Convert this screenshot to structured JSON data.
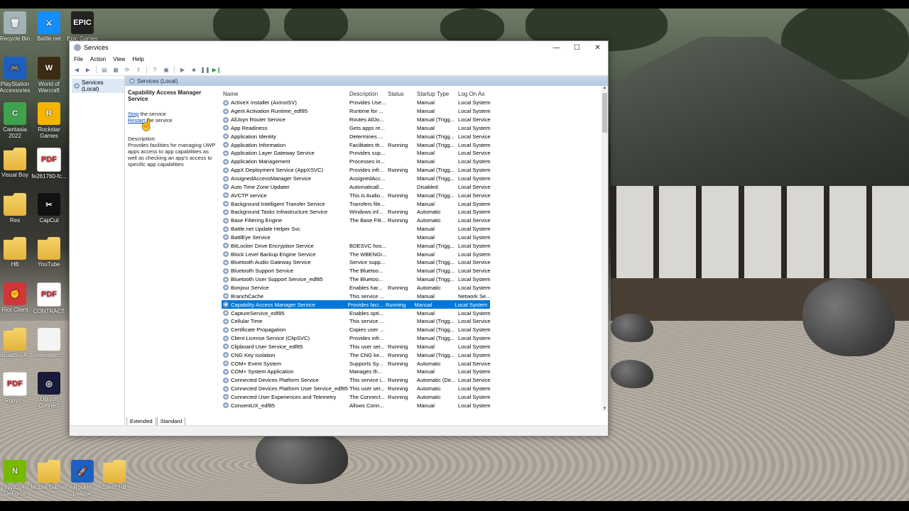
{
  "desktop": {
    "icons": [
      {
        "label": "Recycle Bin",
        "glyph": "🗑",
        "kind": "bin"
      },
      {
        "label": "Battle.net",
        "glyph": "⚔",
        "kind": "app",
        "color": "#148eff"
      },
      {
        "label": "Epic Games",
        "glyph": "EPIC",
        "kind": "app",
        "color": "#222222"
      },
      {
        "label": "PlayStation Accessories",
        "glyph": "🎮",
        "kind": "app",
        "color": "#1d5fbf"
      },
      {
        "label": "World of Warcraft",
        "glyph": "W",
        "kind": "app",
        "color": "#3b2b12"
      },
      {
        "label": "Camtasia 2022",
        "glyph": "C",
        "kind": "app",
        "color": "#3fa34d"
      },
      {
        "label": "Rockstar Games",
        "glyph": "R",
        "kind": "app",
        "color": "#f5b400"
      },
      {
        "label": "Visual Boy",
        "glyph": "",
        "kind": "folder"
      },
      {
        "label": "fe261760-fc...",
        "glyph": "PDF",
        "kind": "pdf"
      },
      {
        "label": "Res",
        "glyph": "",
        "kind": "folder"
      },
      {
        "label": "CapCut",
        "glyph": "✂",
        "kind": "app",
        "color": "#111111"
      },
      {
        "label": "HB",
        "glyph": "",
        "kind": "folder"
      },
      {
        "label": "YouTube",
        "glyph": "",
        "kind": "folder"
      },
      {
        "label": "Riot Client",
        "glyph": "✊",
        "kind": "app",
        "color": "#d13639"
      },
      {
        "label": "CONTRACT",
        "glyph": "PDF",
        "kind": "pdf"
      },
      {
        "label": "VisualBoyA...",
        "glyph": "",
        "kind": "folder"
      },
      {
        "label": "Investwith...",
        "glyph": "",
        "kind": "file"
      },
      {
        "label": "Robyn's",
        "glyph": "PDF",
        "kind": "pdf"
      },
      {
        "label": "Ubisoft Connect",
        "glyph": "◎",
        "kind": "app",
        "color": "#1a1a3a"
      },
      {
        "label": "NVIDIA GeForce",
        "glyph": "N",
        "kind": "app",
        "color": "#76b900"
      },
      {
        "label": "Mobile Games",
        "glyph": "",
        "kind": "folder"
      },
      {
        "label": "Rocket League",
        "glyph": "🚀",
        "kind": "app",
        "color": "#1f5fbf"
      },
      {
        "label": "Silent Hill",
        "glyph": "",
        "kind": "folder"
      }
    ]
  },
  "window": {
    "title": "Services",
    "controls": {
      "minimize": "—",
      "maximize": "☐",
      "close": "✕"
    },
    "menu": [
      "File",
      "Action",
      "View",
      "Help"
    ],
    "tree_node": "Services (Local)",
    "content_header": "Services (Local)",
    "selected_service": {
      "title": "Capability Access Manager Service",
      "stop_link": "Stop",
      "stop_suffix": " the service",
      "restart_link": "Restart",
      "restart_suffix": " the service",
      "description_label": "Description:",
      "description": "Provides facilities for managing UWP apps access to app capabilities as well as checking an app's access to specific app capabilities"
    },
    "columns": [
      "Name",
      "Description",
      "Status",
      "Startup Type",
      "Log On As"
    ],
    "rows": [
      [
        "ActiveX Installer (AxInstSV)",
        "Provides Use...",
        "",
        "Manual",
        "Local System"
      ],
      [
        "Agent Activation Runtime_edf85",
        "Runtime for ...",
        "",
        "Manual",
        "Local System"
      ],
      [
        "AllJoyn Router Service",
        "Routes AllJo...",
        "",
        "Manual (Trigg...",
        "Local Service"
      ],
      [
        "App Readiness",
        "Gets apps re...",
        "",
        "Manual",
        "Local System"
      ],
      [
        "Application Identity",
        "Determines ...",
        "",
        "Manual (Trigg...",
        "Local Service"
      ],
      [
        "Application Information",
        "Facilitates th...",
        "Running",
        "Manual (Trigg...",
        "Local System"
      ],
      [
        "Application Layer Gateway Service",
        "Provides sup...",
        "",
        "Manual",
        "Local Service"
      ],
      [
        "Application Management",
        "Processes in...",
        "",
        "Manual",
        "Local System"
      ],
      [
        "AppX Deployment Service (AppXSVC)",
        "Provides infr...",
        "Running",
        "Manual (Trigg...",
        "Local System"
      ],
      [
        "AssignedAccessManager Service",
        "AssignedAcc...",
        "",
        "Manual (Trigg...",
        "Local System"
      ],
      [
        "Auto Time Zone Updater",
        "Automaticall...",
        "",
        "Disabled",
        "Local Service"
      ],
      [
        "AVCTP service",
        "This is Audio...",
        "Running",
        "Manual (Trigg...",
        "Local Service"
      ],
      [
        "Background Intelligent Transfer Service",
        "Transfers file...",
        "",
        "Manual",
        "Local System"
      ],
      [
        "Background Tasks Infrastructure Service",
        "Windows inf...",
        "Running",
        "Automatic",
        "Local System"
      ],
      [
        "Base Filtering Engine",
        "The Base Filt...",
        "Running",
        "Automatic",
        "Local Service"
      ],
      [
        "Battle.net Update Helper Svc",
        "",
        "",
        "Manual",
        "Local System"
      ],
      [
        "BattlEye Service",
        "",
        "",
        "Manual",
        "Local System"
      ],
      [
        "BitLocker Drive Encryption Service",
        "BDESVC hos...",
        "",
        "Manual (Trigg...",
        "Local System"
      ],
      [
        "Block Level Backup Engine Service",
        "The WBENGI...",
        "",
        "Manual",
        "Local System"
      ],
      [
        "Bluetooth Audio Gateway Service",
        "Service supp...",
        "",
        "Manual (Trigg...",
        "Local Service"
      ],
      [
        "Bluetooth Support Service",
        "The Bluetoo...",
        "",
        "Manual (Trigg...",
        "Local Service"
      ],
      [
        "Bluetooth User Support Service_edf85",
        "The Bluetoo...",
        "",
        "Manual (Trigg...",
        "Local System"
      ],
      [
        "Bonjour Service",
        "Enables har...",
        "Running",
        "Automatic",
        "Local System"
      ],
      [
        "BranchCache",
        "This service ...",
        "",
        "Manual",
        "Network Se..."
      ],
      [
        "Capability Access Manager Service",
        "Provides faci...",
        "Running",
        "Manual",
        "Local System"
      ],
      [
        "CaptureService_edf85",
        "Enables opti...",
        "",
        "Manual",
        "Local System"
      ],
      [
        "Cellular Time",
        "This service ...",
        "",
        "Manual (Trigg...",
        "Local Service"
      ],
      [
        "Certificate Propagation",
        "Copies user ...",
        "",
        "Manual (Trigg...",
        "Local System"
      ],
      [
        "Client License Service (ClipSVC)",
        "Provides infr...",
        "",
        "Manual (Trigg...",
        "Local System"
      ],
      [
        "Clipboard User Service_edf85",
        "This user ser...",
        "Running",
        "Manual",
        "Local System"
      ],
      [
        "CNG Key Isolation",
        "The CNG ke...",
        "Running",
        "Manual (Trigg...",
        "Local System"
      ],
      [
        "COM+ Event System",
        "Supports Sy...",
        "Running",
        "Automatic",
        "Local Service"
      ],
      [
        "COM+ System Application",
        "Manages th...",
        "",
        "Manual",
        "Local System"
      ],
      [
        "Connected Devices Platform Service",
        "This service i...",
        "Running",
        "Automatic (De...",
        "Local Service"
      ],
      [
        "Connected Devices Platform User Service_edf85",
        "This user ser...",
        "Running",
        "Automatic",
        "Local System"
      ],
      [
        "Connected User Experiences and Telemetry",
        "The Connect...",
        "Running",
        "Automatic",
        "Local System"
      ],
      [
        "ConsentUX_edf85",
        "Allows Conn...",
        "",
        "Manual",
        "Local System"
      ]
    ],
    "selected_index": 24,
    "tabs": [
      "Extended",
      "Standard"
    ],
    "colors": {
      "selection": "#0078d7",
      "header": "#b5c9e1"
    }
  }
}
